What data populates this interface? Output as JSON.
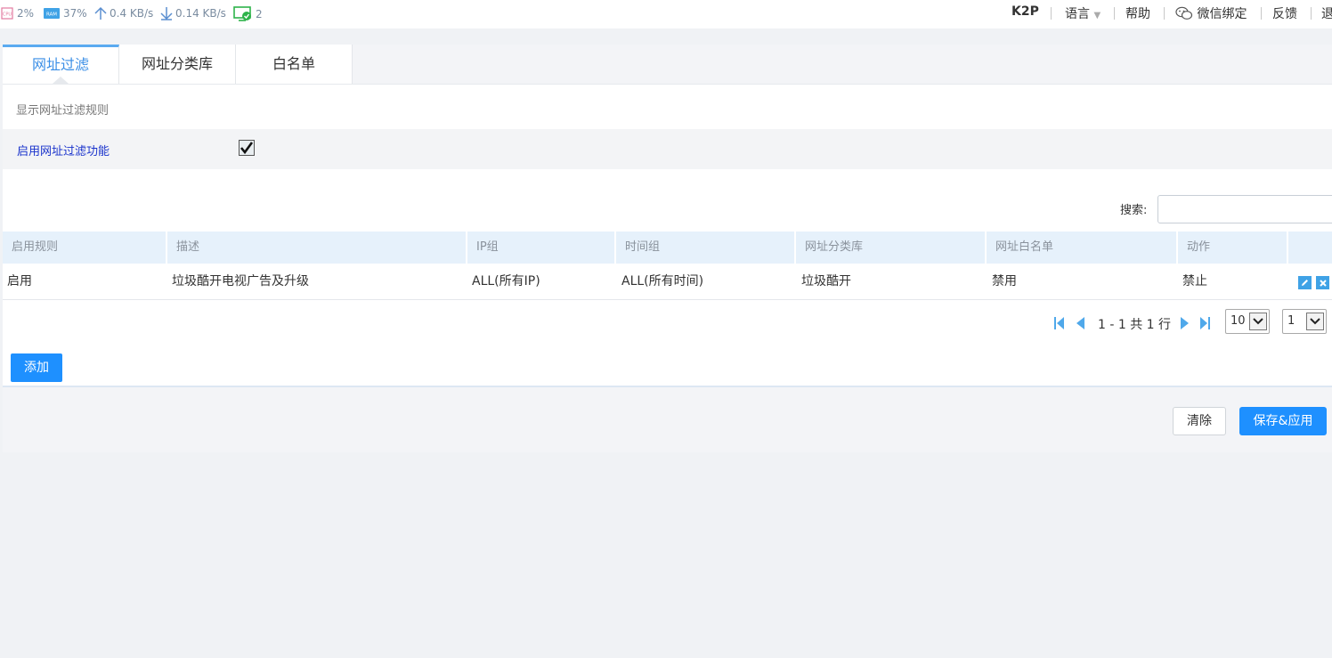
{
  "status": {
    "cpu_icon_label": "CPU",
    "cpu": "2%",
    "ram_icon_label": "RAM",
    "ram": "37%",
    "upload": "0.4 KB/s",
    "download": "0.14 KB/s",
    "clients": "2"
  },
  "topnav": {
    "model": "K2P",
    "language": "语言",
    "help": "帮助",
    "wechat": "微信绑定",
    "feedback": "反馈",
    "logout": "退"
  },
  "tabs": [
    "网址过滤",
    "网址分类库",
    "白名单"
  ],
  "content": {
    "show_rules": "显示网址过滤规则",
    "enable_label": "启用网址过滤功能",
    "enable_checked": true,
    "search_label": "搜索:",
    "search_value": ""
  },
  "table": {
    "columns": [
      "启用规则",
      "描述",
      "IP组",
      "时间组",
      "网址分类库",
      "网址白名单",
      "动作",
      ""
    ],
    "rows": [
      [
        "启用",
        "垃圾酷开电视广告及升级",
        "ALL(所有IP)",
        "ALL(所有时间)",
        "垃圾酷开",
        "禁用",
        "禁止"
      ]
    ]
  },
  "pager": {
    "info": "1 - 1 共 1 行",
    "page_size": "10",
    "page": "1"
  },
  "buttons": {
    "add": "添加",
    "clear": "清除",
    "save": "保存&应用"
  },
  "colors": {
    "accent": "#1e90ff",
    "tab_active": "#3a8ee6",
    "header_bg": "#e6f1fb",
    "link_blue": "#1a33cc",
    "status_green": "#2db34a"
  }
}
